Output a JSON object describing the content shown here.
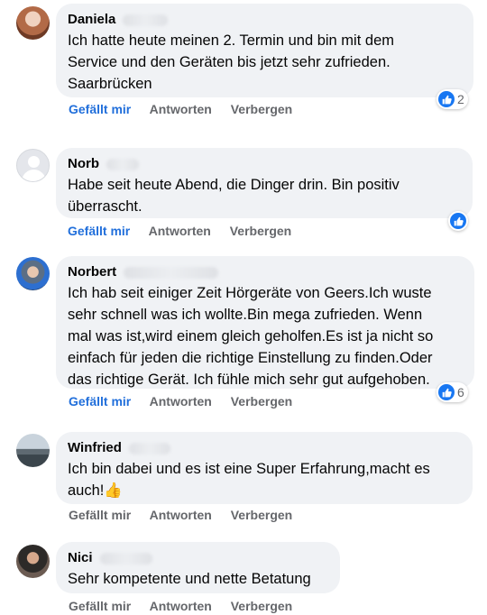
{
  "actions": {
    "like": "Gefällt mir",
    "reply": "Antworten",
    "hide": "Verbergen"
  },
  "colors": {
    "bubble": "#f0f2f5",
    "link_blue": "#216fdb",
    "muted": "#65676b",
    "reaction_blue": "#1877f2"
  },
  "comments": [
    {
      "name": "Daniela",
      "text": "Ich hatte heute meinen 2. Termin und bin mit dem\nService und den Geräten bis jetzt sehr zufrieden.\nSaarbrücken",
      "reaction_icon": "thumbs-up-icon",
      "reactions": "2"
    },
    {
      "name": "Norb",
      "text": "Habe seit heute Abend, die Dinger drin. Bin positiv\nüberrascht.",
      "reaction_icon": "thumbs-up-icon",
      "reactions": ""
    },
    {
      "name": "Norbert",
      "text": "Ich hab seit einiger Zeit Hörgeräte von Geers.Ich wuste\nsehr schnell was ich wollte.Bin mega zufrieden. Wenn\nmal was ist,wird einem gleich geholfen.Es ist ja nicht so\neinfach für jeden die richtige Einstellung zu finden.Oder\ndas richtige Gerät. Ich fühle mich sehr gut aufgehoben.",
      "reaction_icon": "thumbs-up-icon",
      "reactions": "6"
    },
    {
      "name": "Winfried",
      "text": "Ich bin dabei und es ist eine Super Erfahrung,macht es\nauch!👍",
      "reactions": ""
    },
    {
      "name": "Nici",
      "text": "Sehr kompetente und nette Betatung",
      "reactions": ""
    }
  ]
}
